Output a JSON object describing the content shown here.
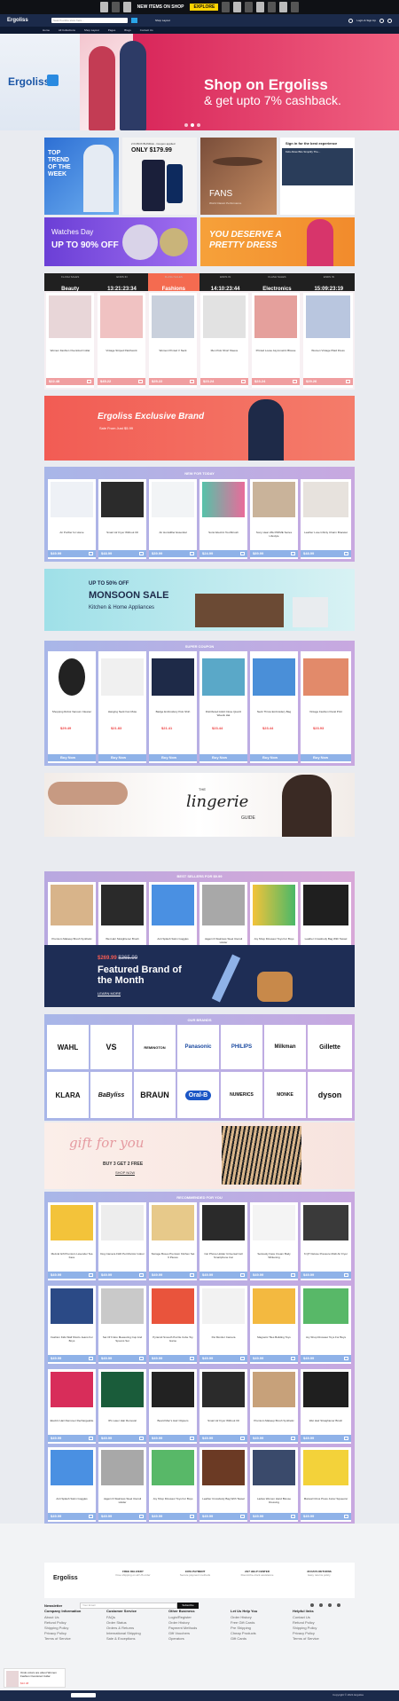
{
  "topbar": {
    "title": "NEW ITEMS ON SHOP",
    "cta": "EXPLORE"
  },
  "header": {
    "logo": "Ergoliss",
    "search_placeholder": "Search entire store here...",
    "shop": "Shop Layout",
    "login": "Login & Sign Up"
  },
  "nav": [
    "Home",
    "All Collections",
    "Shop Layout",
    "Pages",
    "Blogs",
    "Contact Us"
  ],
  "hero": {
    "brand": "Ergoliss",
    "headline": "Shop on Ergoliss",
    "sub": "& get upto 7% cashback."
  },
  "promos": {
    "top_trend": "TOP TREND OF THE WEEK",
    "phone_title": "2 IN BOX BUNDLE - Coupon applied",
    "phone_price": "ONLY $179.99",
    "fans": "FANS",
    "fans_sub": "World Classic Performance",
    "signin": "Sign in for the best experience",
    "signin_sub": "Kids Allow Bits Simplify The...",
    "watches": "Watches Day",
    "watches_pct": "UP TO 90% OFF",
    "pretty": "YOU DESERVE A PRETTY DRESS"
  },
  "flash": [
    {
      "label": "FLASH SALES",
      "cat": "Beauty"
    },
    {
      "label": "ENDS IN",
      "time": "13:21:23:34"
    },
    {
      "label": "FLASH SALES",
      "cat": "Fashions"
    },
    {
      "label": "ENDS IN",
      "time": "14:10:23:44"
    },
    {
      "label": "FLASH SALES",
      "cat": "Electronics"
    },
    {
      "label": "ENDS IN",
      "time": "15:09:23:19"
    }
  ],
  "flash_products": [
    {
      "name": "Women Fashion Oversized Collar",
      "price": "$22.48"
    },
    {
      "name": "Vintage Striped Patchwork",
      "price": "$45.22"
    },
    {
      "name": "Women Printed V Neck",
      "price": "$25.22"
    },
    {
      "name": "Men Polo Short Sleeve",
      "price": "$23.24"
    },
    {
      "name": "Printed Loose Asymmetric Blouse",
      "price": "$23.24"
    },
    {
      "name": "Women Vintage Plaid Dress",
      "price": "$29.26"
    }
  ],
  "exclusive": {
    "title": "Ergoliss Exclusive Brand",
    "sub": "Sale From Just $5.99"
  },
  "new_today": {
    "title": "NEW FOR TODAY",
    "items": [
      {
        "name": "Air Purifier for Home",
        "price": "$49.99"
      },
      {
        "name": "Smart Air Fryer Without Oil",
        "price": "$48.99"
      },
      {
        "name": "Air Humidifier Essential",
        "price": "$39.99"
      },
      {
        "name": "Sonic Electric Toothbrush",
        "price": "$24.99"
      },
      {
        "name": "Sony Hear 26H PRIME Series Lifestyle",
        "price": "$89.99"
      },
      {
        "name": "Leather Luxe Infinity Charm Bracelet",
        "price": "$48.99"
      }
    ]
  },
  "monsoon": {
    "pct": "UP TO 50% OFF",
    "title": "MONSOON SALE",
    "sub": "Kitchen & Home Appliances"
  },
  "coupon": {
    "title": "SUPER COUPON",
    "items": [
      {
        "name": "Shopping Robot Vacuum Cleaner",
        "price": "$29.49",
        "btn": "Buy Now"
      },
      {
        "name": "Hanging Neck Fan Mute",
        "price": "$21.83",
        "btn": "Buy Now"
      },
      {
        "name": "Badge Embroidery Polo Shirt",
        "price": "$21.41",
        "btn": "Buy Now"
      },
      {
        "name": "Distributed Adult Close Quartz Weeds Hat",
        "price": "$23.44",
        "btn": "Buy Now"
      },
      {
        "name": "Neck Throw Embroidery Bag",
        "price": "$23.44",
        "btn": "Buy Now"
      },
      {
        "name": "Vintage Fashion Floral Print",
        "price": "$23.93",
        "btn": "Buy Now"
      }
    ]
  },
  "lingerie": {
    "title": "lingerie",
    "sub": "GUIDE",
    "the": "THE"
  },
  "bestsellers": {
    "title": "BEST SELLERS FOR $9.99",
    "items": [
      {
        "name": "Premium Makeup Brush Synthetic",
        "price": "$9.99"
      },
      {
        "name": "Wet Hair Straightener Brush",
        "price": "$9.99"
      },
      {
        "name": "Anti Splash Swim Goggles",
        "price": "$9.99"
      },
      {
        "name": "Jagermh Stainless Steel Utensil Holder",
        "price": "$9.99"
      },
      {
        "name": "Joy Shop Dinosaur Toys For Boys",
        "price": "$9.99"
      },
      {
        "name": "Leather Crossbody Bag With Tassel",
        "price": "$9.99"
      }
    ]
  },
  "featured": {
    "price": "$269.99",
    "old": "$365.99",
    "title": "Featured Brand of the Month",
    "cta": "LEARN MORE"
  },
  "brands": {
    "title": "OUR BRANDS",
    "list": [
      "WAHL",
      "VS",
      "REMINGTON",
      "Panasonic",
      "PHILIPS",
      "Milkman",
      "Gillette",
      "KLARA",
      "BaByliss",
      "BRAUN",
      "Oral-B",
      "NUMERICS",
      "MONKE",
      "dyson"
    ]
  },
  "gift": {
    "title": "gift for you",
    "deal": "BUY 3 GET 2 FREE",
    "cta": "SHOP NOW"
  },
  "recommended": {
    "title": "RECOMMENDED FOR YOU",
    "items": [
      {
        "name": "Mezcal Gift Premium Lavender Tea Face",
        "price": "$49.99"
      },
      {
        "name": "Dog Camera FHD Pet Monitor Indoor",
        "price": "$49.99"
      },
      {
        "name": "Storage Boxes Premium Kitchen Set 6 Pieces",
        "price": "$49.99"
      },
      {
        "name": "Car Phone Holder Universal Cell Smartphone Car",
        "price": "$49.99"
      },
      {
        "name": "Seriously Face Cream Body Whitening",
        "price": "$49.99"
      },
      {
        "name": "6 QT Deluxe Pressure Multi Air Fryer",
        "price": "$49.99"
      },
      {
        "name": "Fashion Kids Wall Shorts Jeans For Boys",
        "price": "$49.99"
      },
      {
        "name": "Set Of 6 Eco Measuring Cup And Spoons Set",
        "price": "$49.99"
      },
      {
        "name": "Pyramid Smooth Puzzle Cube Toy Game",
        "price": "$49.99"
      },
      {
        "name": "Pet Monitor Camera",
        "price": "$49.99"
      },
      {
        "name": "Magnetic Tiles Building Toys",
        "price": "$49.99"
      },
      {
        "name": "Joy Shop Dinosaur Toys For Boys",
        "price": "$49.99"
      },
      {
        "name": "Electric Hair Remover Rechargeable",
        "price": "$49.99"
      },
      {
        "name": "IPL Laser Hair Removal",
        "price": "$49.99"
      },
      {
        "name": "Beard Men's Hair Clippers",
        "price": "$49.99"
      },
      {
        "name": "Smart Air Fryer Without Oil",
        "price": "$49.99"
      },
      {
        "name": "Premium Makeup Brush Synthetic",
        "price": "$49.99"
      },
      {
        "name": "Wet Hair Straightener Brush",
        "price": "$49.99"
      },
      {
        "name": "Anti Splash Swim Goggles",
        "price": "$49.99"
      },
      {
        "name": "Jagermh Stainless Steel Utensil Holder",
        "price": "$49.99"
      },
      {
        "name": "Joy Shop Dinosaur Toys For Boys",
        "price": "$49.99"
      },
      {
        "name": "Leather Crossbody Bag With Tassel",
        "price": "$49.99"
      },
      {
        "name": "Ladies Women Hand Blouse Dressing",
        "price": "$49.99"
      },
      {
        "name": "Manual Citrus Press Juicer Squeezer",
        "price": "$49.99"
      }
    ]
  },
  "footer": {
    "logo": "Ergoliss",
    "features": [
      {
        "title": "FREE DELIVERY",
        "sub": "Free shipping on all US order"
      },
      {
        "title": "100% PAYMENT",
        "sub": "Secure payment methods"
      },
      {
        "title": "24/7 HELP CENTER",
        "sub": "Round-the-clock assistance"
      },
      {
        "title": "30 DAYS RETURNS",
        "sub": "Easy returns policy"
      }
    ],
    "newsletter": "Newsletter",
    "email_placeholder": "Your Email",
    "subscribe": "Subscribe",
    "cols": [
      {
        "title": "Company Information",
        "links": [
          "About Us",
          "Refund Policy",
          "Shipping Policy",
          "Privacy Policy",
          "Terms of Service"
        ]
      },
      {
        "title": "Customer Service",
        "links": [
          "FAQs",
          "Order Status",
          "Orders & Returns",
          "International Shipping",
          "Sale & Exceptions"
        ]
      },
      {
        "title": "Other Business",
        "links": [
          "Login/Register",
          "Order History",
          "Payment Methods",
          "Gift Vouchers",
          "Operators"
        ]
      },
      {
        "title": "Let Us Help You",
        "links": [
          "Order History",
          "Free Gift Cards",
          "Pre Shipping",
          "Cheap Products",
          "Gift Cards"
        ]
      },
      {
        "title": "Helpful links",
        "links": [
          "Contact Us",
          "Refund Policy",
          "Shipping Policy",
          "Privacy Policy",
          "Terms of Service"
        ]
      }
    ],
    "popup": "Ondo colors are about Women Fashion Oversized Collar",
    "popup_price": "$22.48",
    "copyright": "Copyright © 2021 Ergoliss"
  }
}
